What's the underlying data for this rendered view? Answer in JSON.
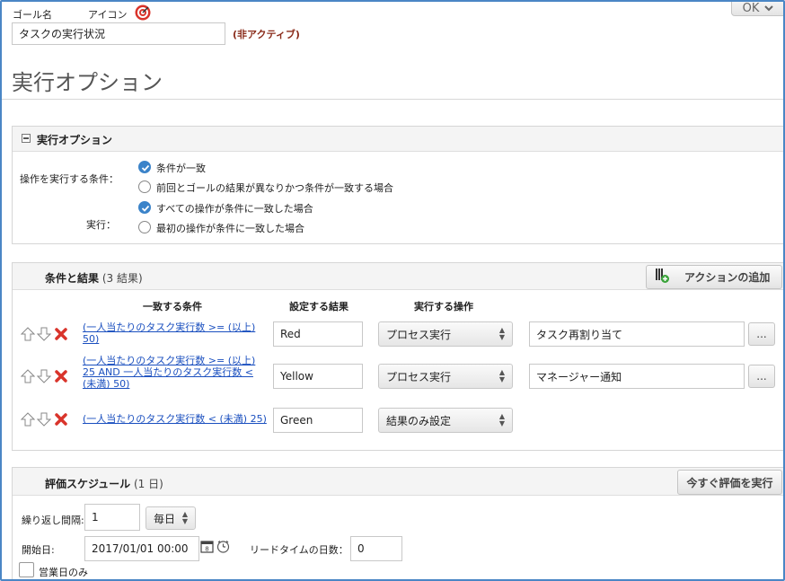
{
  "goal": {
    "name_label": "ゴール名",
    "icon_label": "アイコン",
    "name_value": "タスクの実行状況",
    "status": "(非アクティブ)",
    "ok_label": "OK"
  },
  "page_title": "実行オプション",
  "exec_options": {
    "section_title": "実行オプション",
    "condition_label": "操作を実行する条件：",
    "condition_options": [
      {
        "label": "条件が一致",
        "selected": true
      },
      {
        "label": "前回とゴールの結果が異なりかつ条件が一致する場合",
        "selected": false
      }
    ],
    "exec_label": "実行：",
    "exec_choices": [
      {
        "label": "すべての操作が条件に一致した場合",
        "selected": true
      },
      {
        "label": "最初の操作が条件に一致した場合",
        "selected": false
      }
    ]
  },
  "conditions": {
    "title": "条件と結果",
    "count": "(3 結果)",
    "add_action_label": "アクションの追加",
    "col_condition": "一致する条件",
    "col_result": "設定する結果",
    "col_action": "実行する操作",
    "rows": [
      {
        "condition": "(一人当たりのタスク実行数 >= (以上) 50)",
        "result": "Red",
        "action": "プロセス実行",
        "detail": "タスク再割り当て",
        "more": "..."
      },
      {
        "condition": "(一人当たりのタスク実行数 >= (以上) 25 AND 一人当たりのタスク実行数 < (未満) 50)",
        "result": "Yellow",
        "action": "プロセス実行",
        "detail": "マネージャー通知",
        "more": "..."
      },
      {
        "condition": "(一人当たりのタスク実行数 < (未満) 25)",
        "result": "Green",
        "action": "結果のみ設定",
        "detail": "",
        "more": ""
      }
    ]
  },
  "schedule": {
    "title": "評価スケジュール",
    "count": "(1 日)",
    "run_now_label": "今すぐ評価を実行",
    "interval_label": "繰り返し間隔:",
    "interval_value": "1",
    "interval_unit": "毎日",
    "start_label": "開始日:",
    "start_value": "2017/01/01 00:00",
    "lead_label": "リードタイムの日数：",
    "lead_value": "0",
    "business_days_label": "営業日のみ"
  },
  "colors": {
    "accent": "#3b83c9",
    "link": "#1a4fbf",
    "delete": "#d9342b",
    "status_text": "#8a2b1a"
  }
}
